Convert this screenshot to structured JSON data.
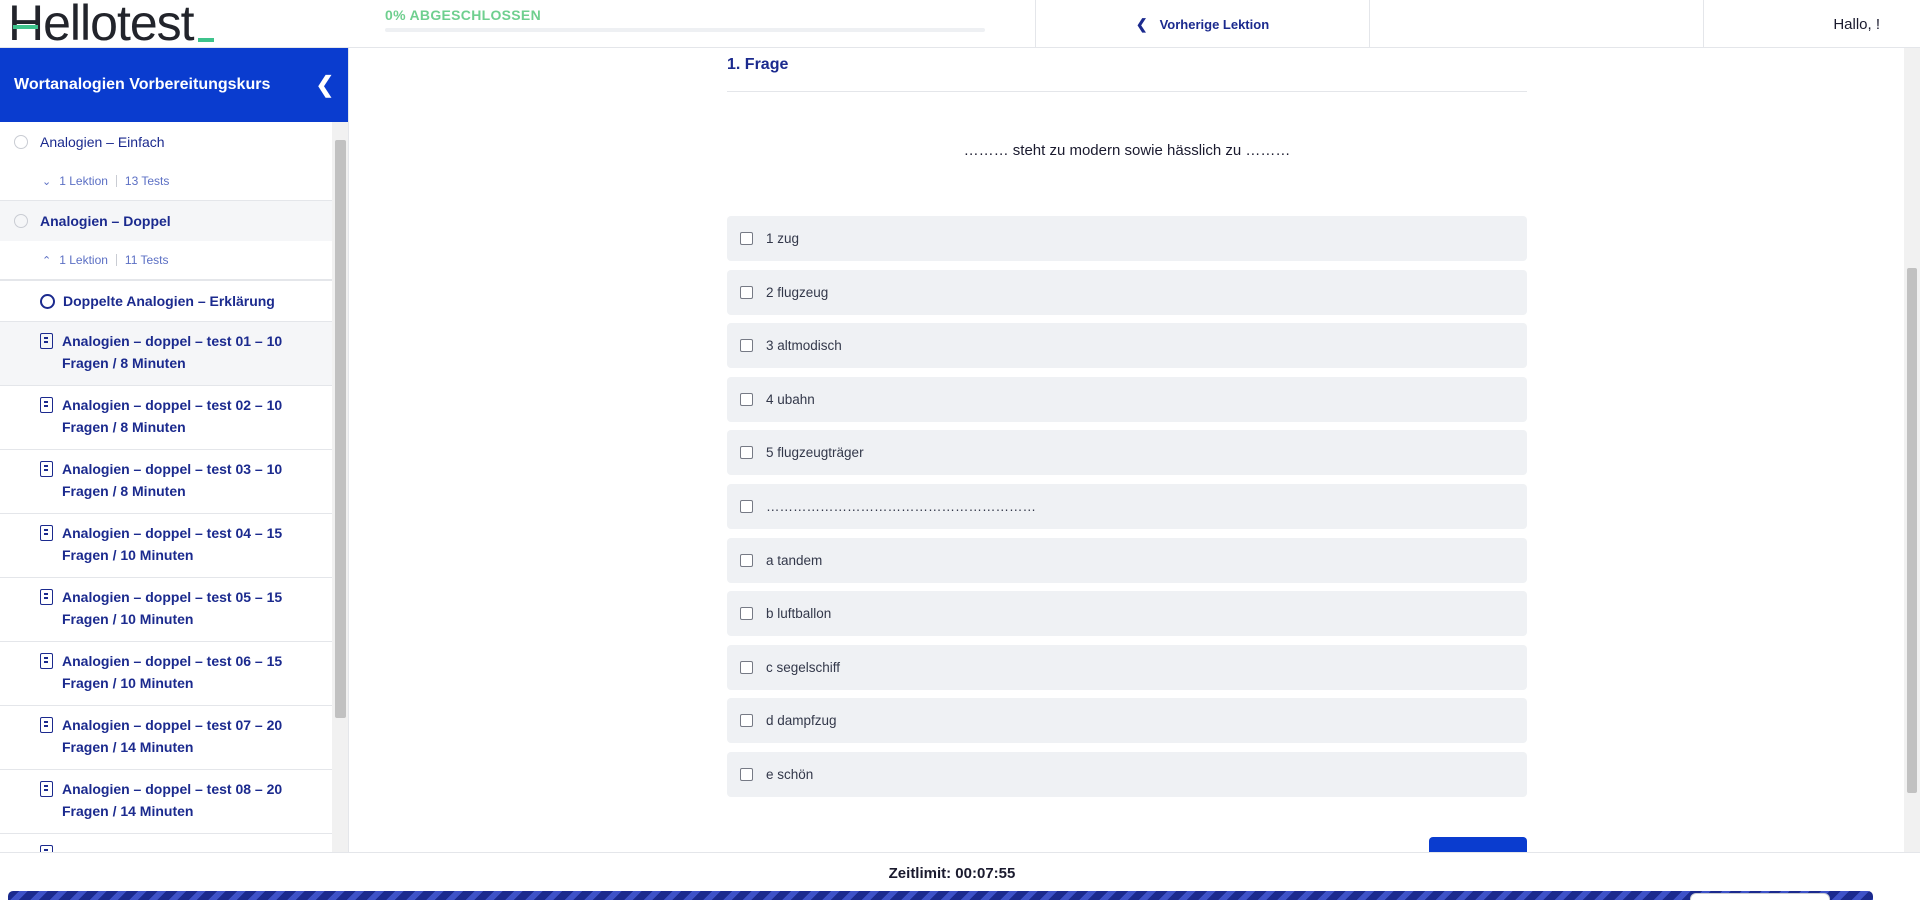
{
  "header": {
    "logo_text": "Hellotest",
    "progress_label": "0% ABGESCHLOSSEN",
    "progress_fraction": 0.0,
    "prev_lesson_label": "Vorherige Lektion",
    "greeting": "Hallo, !"
  },
  "sidebar": {
    "title": "Wortanalogien Vorbereitungskurs",
    "sections": [
      {
        "title": "Analogien – Einfach",
        "lessons": "1 Lektion",
        "tests": "13 Tests"
      },
      {
        "title": "Analogien – Doppel",
        "lessons": "1 Lektion",
        "tests": "11 Tests"
      }
    ],
    "items": [
      {
        "label": "Doppelte Analogien – Erklärung"
      },
      {
        "label": "Analogien – doppel – test 01 – 10 Fragen / 8 Minuten"
      },
      {
        "label": "Analogien – doppel – test 02 – 10 Fragen / 8 Minuten"
      },
      {
        "label": "Analogien – doppel – test 03 – 10 Fragen / 8 Minuten"
      },
      {
        "label": "Analogien – doppel – test 04 – 15 Fragen / 10 Minuten"
      },
      {
        "label": "Analogien – doppel – test 05 – 15 Fragen / 10 Minuten"
      },
      {
        "label": "Analogien – doppel – test 06 – 15 Fragen / 10 Minuten"
      },
      {
        "label": "Analogien – doppel – test 07 – 20 Fragen / 14 Minuten"
      },
      {
        "label": "Analogien – doppel – test 08 – 20 Fragen / 14 Minuten"
      }
    ]
  },
  "question": {
    "title": "1. Frage",
    "text": "……… steht zu modern sowie hässlich zu ………",
    "answers": [
      "1 zug",
      "2 flugzeug",
      "3 altmodisch",
      "4 ubahn",
      "5 flugzeugträger",
      "……………………………………………………",
      "a tandem",
      "b luftballon",
      "c segelschiff",
      "d dampfzug",
      "e schön"
    ]
  },
  "footer": {
    "timer": "Zeitlimit: 00:07:55"
  },
  "colors": {
    "brand_blue": "#0a3ccf",
    "link_navy": "#1b2a8e",
    "accent_green": "#6fcf8f"
  }
}
